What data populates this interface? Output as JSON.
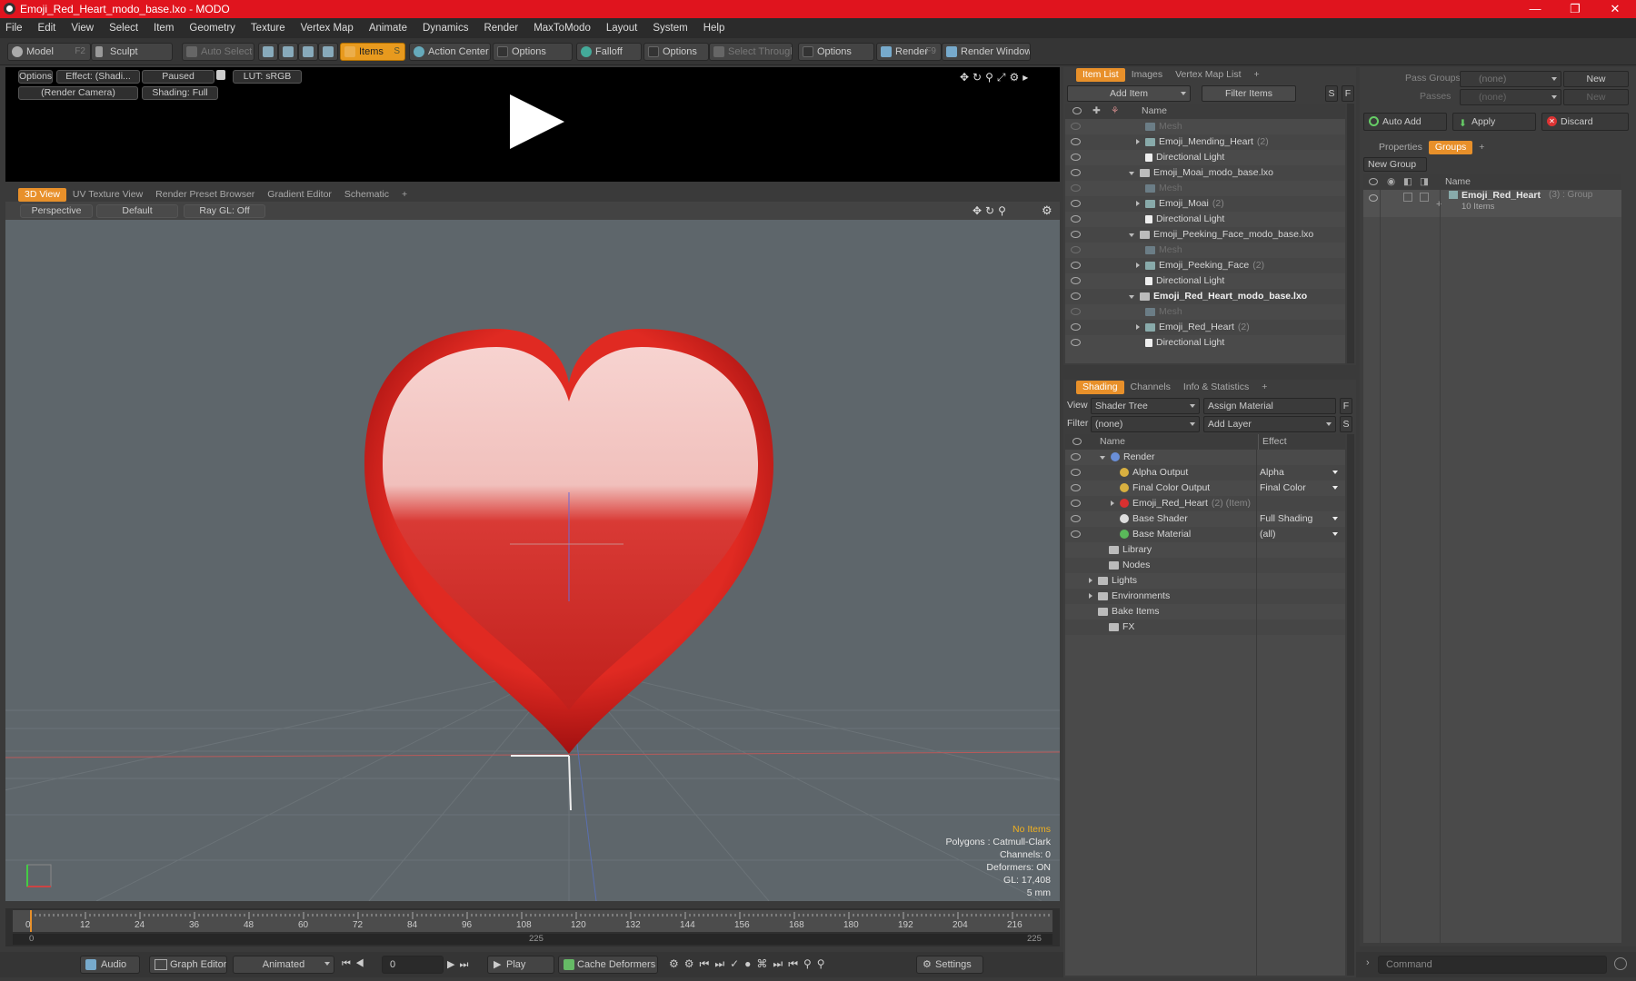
{
  "window": {
    "title": "Emoji_Red_Heart_modo_base.lxo - MODO",
    "minimize": "—",
    "maximize": "❐",
    "close": "✕"
  },
  "menu": [
    "File",
    "Edit",
    "View",
    "Select",
    "Item",
    "Geometry",
    "Texture",
    "Vertex Map",
    "Animate",
    "Dynamics",
    "Render",
    "MaxToModo",
    "Layout",
    "System",
    "Help"
  ],
  "toolbar": {
    "model": "Model",
    "model_key": "F2",
    "sculpt": "Sculpt",
    "auto_select": "Auto Select",
    "items": "Items",
    "items_key": "S",
    "action_center": "Action Center",
    "options1": "Options",
    "falloff": "Falloff",
    "options2": "Options",
    "select_through": "Select Through",
    "options3": "Options",
    "render": "Render",
    "render_key": "F9",
    "render_window": "Render Window"
  },
  "preview": {
    "options": "Options",
    "effect": "Effect: (Shadi...",
    "paused": "Paused",
    "lut": "LUT: sRGB",
    "camera": "(Render Camera)",
    "shading": "Shading: Full"
  },
  "view_tabs": [
    "3D View",
    "UV Texture View",
    "Render Preset Browser",
    "Gradient Editor",
    "Schematic",
    "+"
  ],
  "viewport": {
    "perspective": "Perspective",
    "default": "Default",
    "raygl": "Ray GL: Off",
    "info": [
      "No Items",
      "Polygons : Catmull-Clark",
      "Channels: 0",
      "Deformers: ON",
      "GL: 17,408",
      "5 mm"
    ]
  },
  "timeline": {
    "ticks": [
      "0",
      "12",
      "24",
      "36",
      "48",
      "60",
      "72",
      "84",
      "96",
      "108",
      "120",
      "132",
      "144",
      "156",
      "168",
      "180",
      "192",
      "204",
      "216"
    ],
    "start": "0",
    "mid": "225",
    "end": "225"
  },
  "bottom": {
    "audio": "Audio",
    "graph_editor": "Graph Editor",
    "animated": "Animated",
    "frame": "0",
    "play": "Play",
    "cache": "Cache Deformers",
    "settings": "Settings"
  },
  "item_list": {
    "tabs": [
      "Item List",
      "Images",
      "Vertex Map List",
      "+"
    ],
    "add_item": "Add Item",
    "filter_items": "Filter Items",
    "s": "S",
    "f": "F",
    "name_header": "Name",
    "rows": [
      {
        "label": "Mesh",
        "indent": 3,
        "kind": "mesh"
      },
      {
        "label": "Emoji_Mending_Heart",
        "suffix": "(2)",
        "indent": 3,
        "kind": "group",
        "expand": true
      },
      {
        "label": "Directional Light",
        "indent": 3,
        "kind": "light"
      },
      {
        "label": "Emoji_Moai_modo_base.lxo",
        "indent": 2,
        "kind": "scene",
        "open": true
      },
      {
        "label": "Mesh",
        "indent": 3,
        "kind": "mesh"
      },
      {
        "label": "Emoji_Moai",
        "suffix": "(2)",
        "indent": 3,
        "kind": "group",
        "expand": true
      },
      {
        "label": "Directional Light",
        "indent": 3,
        "kind": "light"
      },
      {
        "label": "Emoji_Peeking_Face_modo_base.lxo",
        "indent": 2,
        "kind": "scene",
        "open": true
      },
      {
        "label": "Mesh",
        "indent": 3,
        "kind": "mesh"
      },
      {
        "label": "Emoji_Peeking_Face",
        "suffix": "(2)",
        "indent": 3,
        "kind": "group",
        "expand": true
      },
      {
        "label": "Directional Light",
        "indent": 3,
        "kind": "light"
      },
      {
        "label": "Emoji_Red_Heart_modo_base.lxo",
        "indent": 2,
        "kind": "scene",
        "open": true,
        "bold": true
      },
      {
        "label": "Mesh",
        "indent": 3,
        "kind": "mesh"
      },
      {
        "label": "Emoji_Red_Heart",
        "suffix": "(2)",
        "indent": 3,
        "kind": "group",
        "expand": true
      },
      {
        "label": "Directional Light",
        "indent": 3,
        "kind": "light"
      }
    ]
  },
  "shading": {
    "tabs": [
      "Shading",
      "Channels",
      "Info & Statistics",
      "+"
    ],
    "view_label": "View",
    "view_value": "Shader Tree",
    "assign_material": "Assign Material",
    "f": "F",
    "filter_label": "Filter",
    "filter_value": "(none)",
    "add_layer": "Add Layer",
    "s": "S",
    "name_header": "Name",
    "effect_header": "Effect",
    "rows": [
      {
        "label": "Render",
        "effect": "",
        "indent": 1,
        "open": true
      },
      {
        "label": "Alpha Output",
        "effect": "Alpha",
        "indent": 2
      },
      {
        "label": "Final Color Output",
        "effect": "Final Color",
        "indent": 2
      },
      {
        "label": "Emoji_Red_Heart",
        "suffix": "(2) (Item)",
        "effect": "",
        "indent": 2,
        "expand": true
      },
      {
        "label": "Base Shader",
        "effect": "Full Shading",
        "indent": 2
      },
      {
        "label": "Base Material",
        "effect": "(all)",
        "indent": 2
      },
      {
        "label": "Library",
        "effect": "",
        "indent": 1
      },
      {
        "label": "Nodes",
        "effect": "",
        "indent": 1
      },
      {
        "label": "Lights",
        "effect": "",
        "indent": 0,
        "expand": true
      },
      {
        "label": "Environments",
        "effect": "",
        "indent": 0,
        "expand": true
      },
      {
        "label": "Bake Items",
        "effect": "",
        "indent": 0
      },
      {
        "label": "FX",
        "effect": "",
        "indent": 1
      }
    ]
  },
  "groups_panel": {
    "pass_groups_label": "Pass Groups",
    "pass_groups_value": "(none)",
    "new1": "New",
    "passes_label": "Passes",
    "passes_value": "(none)",
    "new2": "New",
    "auto_add": "Auto Add",
    "apply": "Apply",
    "discard": "Discard",
    "tabs": [
      "Properties",
      "Groups",
      "+"
    ],
    "new_group": "New Group",
    "name_header": "Name",
    "group_name": "Emoji_Red_Heart",
    "group_suffix": "(3) : Group",
    "group_items": "10 Items",
    "command_placeholder": "Command"
  }
}
